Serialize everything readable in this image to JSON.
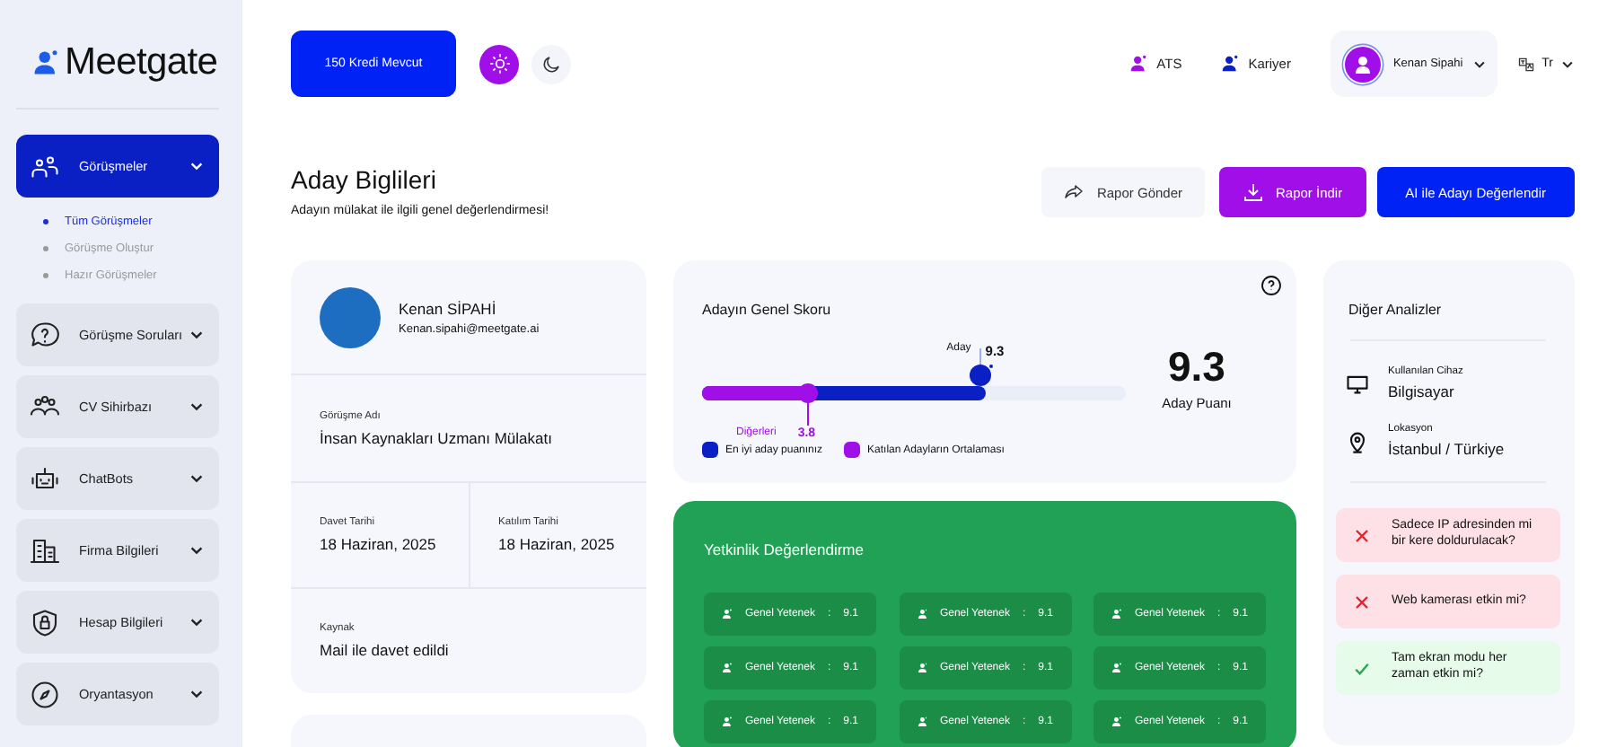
{
  "logo": {
    "text": "Meetgate"
  },
  "sidebar": {
    "items": [
      {
        "label": "Görüşmeler",
        "selected": true,
        "children": [
          {
            "label": "Tüm Görüşmeler",
            "selected": true
          },
          {
            "label": "Görüşme Oluştur",
            "selected": false
          },
          {
            "label": "Hazır Görüşmeler",
            "selected": false
          }
        ]
      },
      {
        "label": "Görüşme Soruları",
        "selected": false
      },
      {
        "label": "CV Sihirbazı",
        "selected": false
      },
      {
        "label": "ChatBots",
        "selected": false
      },
      {
        "label": "Firma Bilgileri",
        "selected": false
      },
      {
        "label": "Hesap Bilgileri",
        "selected": false
      },
      {
        "label": "Oryantasyon",
        "selected": false
      }
    ]
  },
  "topbar": {
    "credits": "150 Kredi Mevcut",
    "modes": [
      {
        "kind": "light",
        "selected": true
      },
      {
        "kind": "dark",
        "selected": false
      }
    ],
    "links": [
      {
        "label": "ATS",
        "color": "#a10fe8"
      },
      {
        "label": "Kariyer",
        "color": "#0a1fc4"
      }
    ],
    "user": "Kenan Sipahi",
    "language": "Tr"
  },
  "header": {
    "title": "Aday Biglileri",
    "subtitle": "Adayın mülakat ile ilgili genel değerlendirmesi!",
    "buttons": [
      {
        "label": "Rapor Gönder",
        "kind": "plain"
      },
      {
        "label": "Rapor İndir",
        "kind": "download"
      },
      {
        "label": "AI ile Adayı Değerlendir",
        "kind": "primary"
      }
    ]
  },
  "candidate": {
    "name": "Kenan SİPAHİ",
    "email": "Kenan.sipahi@meetgate.ai",
    "fields": [
      {
        "label": "Görüşme Adı",
        "value": "İnsan Kaynakları Uzmanı Mülakatı"
      },
      {
        "label": "Davet Tarihi",
        "value": "18 Haziran, 2025"
      },
      {
        "label": "Katılım Tarihi",
        "value": "18 Haziran, 2025"
      },
      {
        "label": "Kaynak",
        "value": "Mail ile davet edildi"
      }
    ]
  },
  "score": {
    "title": "Adayın Genel Skoru",
    "candidate": {
      "label": "Aday",
      "value": "9.3",
      "level": 0.67
    },
    "others": {
      "label": "Diğerleri",
      "value": "3.8",
      "level": 0.25
    },
    "big_value": "9.3",
    "big_label": "Aday Puanı",
    "legend": [
      {
        "label": "En iyi aday puanınız",
        "color": "#0a1fc4"
      },
      {
        "label": "Katılan Adayların Ortalaması",
        "color": "#a10fe8"
      }
    ]
  },
  "competency": {
    "title": "Yetkinlik Değerlendirme",
    "items": [
      {
        "label": "Genel Yetenek",
        "sep": ":",
        "value": "9.1"
      },
      {
        "label": "Genel Yetenek",
        "sep": ":",
        "value": "9.1"
      },
      {
        "label": "Genel Yetenek",
        "sep": ":",
        "value": "9.1"
      },
      {
        "label": "Genel Yetenek",
        "sep": ":",
        "value": "9.1"
      },
      {
        "label": "Genel Yetenek",
        "sep": ":",
        "value": "9.1"
      },
      {
        "label": "Genel Yetenek",
        "sep": ":",
        "value": "9.1"
      },
      {
        "label": "Genel Yetenek",
        "sep": ":",
        "value": "9.1"
      },
      {
        "label": "Genel Yetenek",
        "sep": ":",
        "value": "9.1"
      },
      {
        "label": "Genel Yetenek",
        "sep": ":",
        "value": "9.1"
      }
    ]
  },
  "analysis": {
    "title": "Diğer Analizler",
    "facts": [
      {
        "label": "Kullanılan Cihaz",
        "value": "Bilgisayar",
        "kind": "device"
      },
      {
        "label": "Lokasyon",
        "value": "İstanbul / Türkiye",
        "kind": "location"
      }
    ],
    "checks": [
      {
        "text": "Sadece IP adresinden mi bir kere doldurulacak?",
        "passed": false
      },
      {
        "text": "Web kamerası etkin mi?",
        "passed": false
      },
      {
        "text": "Tam ekran modu her zaman etkin mi?",
        "passed": true
      }
    ]
  }
}
